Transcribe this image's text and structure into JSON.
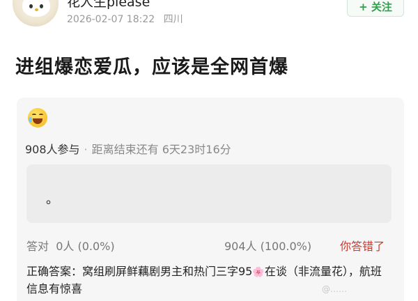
{
  "header": {
    "username": "花人生please",
    "date": "2026-02-07 18:22",
    "location": "四川",
    "follow_label": "+ 关注"
  },
  "post": {
    "title": "进组爆恋爱瓜，应该是全网首爆"
  },
  "quiz": {
    "emoji_name": "laughing-tears-icon",
    "participants": "908人参与",
    "separator": "·",
    "time_remaining": "距离结束还有 6天23时16分",
    "answer_text": "。",
    "correct_label": "答对",
    "correct_count": "0人 (0.0%)",
    "wrong_count": "904人 (100.0%)",
    "wrong_label": "你答错了",
    "answer_prefix": "正确答案：窝组刷屏鲜藕剧男主和热门三字95",
    "answer_suffix": "在谈（非流量花），航班信息有惊喜",
    "flower_glyph": "🌸"
  },
  "watermark": "@……"
}
